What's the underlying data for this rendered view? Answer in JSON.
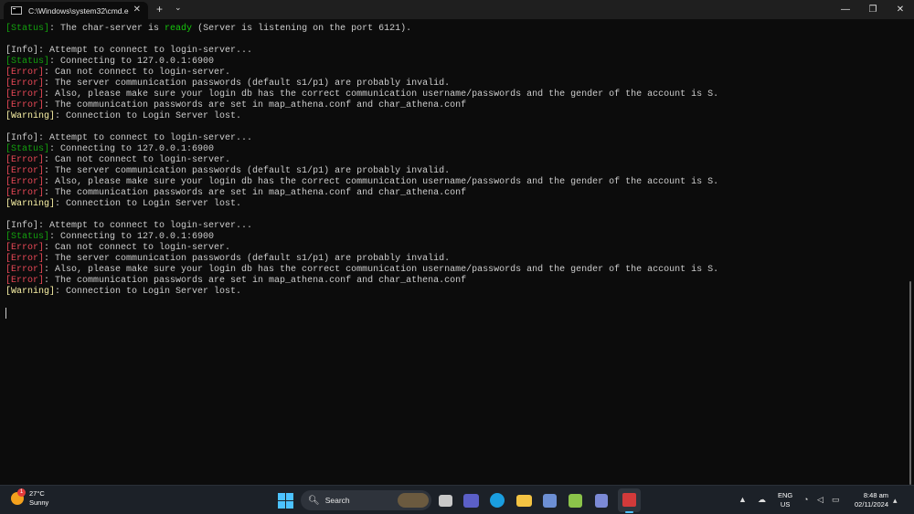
{
  "window": {
    "tab_title": "C:\\Windows\\system32\\cmd.e",
    "tab_close": "✕",
    "new_tab": "+",
    "tab_dropdown": "⌄",
    "minimize": "—",
    "maximize": "❐",
    "close": "✕"
  },
  "console": {
    "lines": [
      [
        {
          "t": "[Status]",
          "c": "status"
        },
        {
          "t": ": The char-server is ",
          "c": "info"
        },
        {
          "t": "ready",
          "c": "ready"
        },
        {
          "t": " (Server is listening on the port 6121).",
          "c": "info"
        }
      ],
      [],
      [
        {
          "t": "[Info]: Attempt to connect to login-server...",
          "c": "info"
        }
      ],
      [
        {
          "t": "[Status]",
          "c": "status"
        },
        {
          "t": ": Connecting to 127.0.0.1:6900",
          "c": "info"
        }
      ],
      [
        {
          "t": "[Error]",
          "c": "error"
        },
        {
          "t": ": Can not connect to login-server.",
          "c": "info"
        }
      ],
      [
        {
          "t": "[Error]",
          "c": "error"
        },
        {
          "t": ": The server communication passwords (default s1/p1) are probably invalid.",
          "c": "info"
        }
      ],
      [
        {
          "t": "[Error]",
          "c": "error"
        },
        {
          "t": ": Also, please make sure your login db has the correct communication username/passwords and the gender of the account is S.",
          "c": "info"
        }
      ],
      [
        {
          "t": "[Error]",
          "c": "error"
        },
        {
          "t": ": The communication passwords are set in map_athena.conf and char_athena.conf",
          "c": "info"
        }
      ],
      [
        {
          "t": "[Warning]",
          "c": "warn"
        },
        {
          "t": ": Connection to Login Server lost.",
          "c": "info"
        }
      ],
      [],
      [
        {
          "t": "[Info]: Attempt to connect to login-server...",
          "c": "info"
        }
      ],
      [
        {
          "t": "[Status]",
          "c": "status"
        },
        {
          "t": ": Connecting to 127.0.0.1:6900",
          "c": "info"
        }
      ],
      [
        {
          "t": "[Error]",
          "c": "error"
        },
        {
          "t": ": Can not connect to login-server.",
          "c": "info"
        }
      ],
      [
        {
          "t": "[Error]",
          "c": "error"
        },
        {
          "t": ": The server communication passwords (default s1/p1) are probably invalid.",
          "c": "info"
        }
      ],
      [
        {
          "t": "[Error]",
          "c": "error"
        },
        {
          "t": ": Also, please make sure your login db has the correct communication username/passwords and the gender of the account is S.",
          "c": "info"
        }
      ],
      [
        {
          "t": "[Error]",
          "c": "error"
        },
        {
          "t": ": The communication passwords are set in map_athena.conf and char_athena.conf",
          "c": "info"
        }
      ],
      [
        {
          "t": "[Warning]",
          "c": "warn"
        },
        {
          "t": ": Connection to Login Server lost.",
          "c": "info"
        }
      ],
      [],
      [
        {
          "t": "[Info]: Attempt to connect to login-server...",
          "c": "info"
        }
      ],
      [
        {
          "t": "[Status]",
          "c": "status"
        },
        {
          "t": ": Connecting to 127.0.0.1:6900",
          "c": "info"
        }
      ],
      [
        {
          "t": "[Error]",
          "c": "error"
        },
        {
          "t": ": Can not connect to login-server.",
          "c": "info"
        }
      ],
      [
        {
          "t": "[Error]",
          "c": "error"
        },
        {
          "t": ": The server communication passwords (default s1/p1) are probably invalid.",
          "c": "info"
        }
      ],
      [
        {
          "t": "[Error]",
          "c": "error"
        },
        {
          "t": ": Also, please make sure your login db has the correct communication username/passwords and the gender of the account is S.",
          "c": "info"
        }
      ],
      [
        {
          "t": "[Error]",
          "c": "error"
        },
        {
          "t": ": The communication passwords are set in map_athena.conf and char_athena.conf",
          "c": "info"
        }
      ],
      [
        {
          "t": "[Warning]",
          "c": "warn"
        },
        {
          "t": ": Connection to Login Server lost.",
          "c": "info"
        }
      ]
    ]
  },
  "taskbar": {
    "weather_badge": "1",
    "weather_temp": "27°C",
    "weather_desc": "Sunny",
    "search_placeholder": "Search",
    "lang_top": "ENG",
    "lang_bottom": "US",
    "time": "8:48 am",
    "date": "02/11/2024",
    "icons": [
      "windows-start-icon",
      "task-view-icon",
      "teams-icon",
      "edge-icon",
      "file-explorer-icon",
      "network-tool-icon",
      "notepad-plus-icon",
      "app-icon",
      "terminal-icon"
    ]
  },
  "colors": {
    "status": "#13a10e",
    "error": "#e74856",
    "warning": "#f9f1a5",
    "info": "#cccccc",
    "ready": "#16c60c"
  }
}
